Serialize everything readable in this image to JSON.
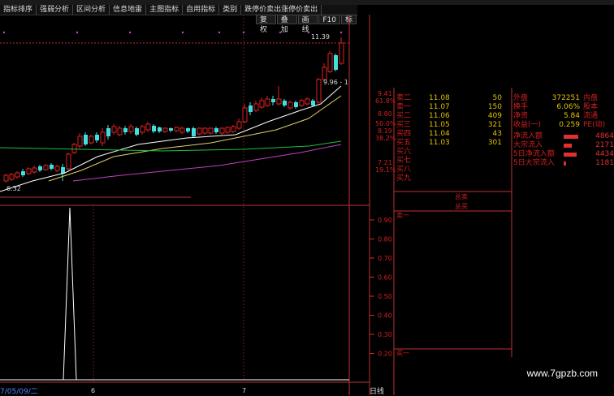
{
  "menu": [
    "指标排序",
    "强弱分析",
    "区间分析",
    "信息地雷",
    "主图指标",
    "自用指标",
    "类别",
    "跌停价卖出涨停价卖出"
  ],
  "subtoolbar": [
    "复权",
    "叠加",
    "画线",
    "F10",
    "标"
  ],
  "price_axis": [
    "9.41",
    "8.80",
    "8.19",
    "7.21"
  ],
  "pct_axis": [
    "61.8%",
    "50.0%",
    "38.2%",
    "19.1%"
  ],
  "hi_label": "11.39",
  "lo_label": "6.32",
  "ma_label": "9.96 - 1",
  "orderbook": {
    "asks": [
      {
        "label": "卖二",
        "price": "11.08",
        "vol": "50"
      },
      {
        "label": "卖一",
        "price": "11.07",
        "vol": "150"
      }
    ],
    "bids": [
      {
        "label": "买二",
        "price": "11.06",
        "vol": "409"
      },
      {
        "label": "买三",
        "price": "11.05",
        "vol": "321"
      },
      {
        "label": "买四",
        "price": "11.04",
        "vol": "43"
      },
      {
        "label": "买五",
        "price": "11.03",
        "vol": "301"
      },
      {
        "label": "买六",
        "price": "",
        "vol": ""
      },
      {
        "label": "买七",
        "price": "",
        "vol": ""
      },
      {
        "label": "买八",
        "price": "",
        "vol": ""
      },
      {
        "label": "买九",
        "price": "",
        "vol": ""
      }
    ]
  },
  "info": [
    {
      "k": "外盘",
      "v": "372251",
      "k2": "内盘"
    },
    {
      "k": "换手",
      "v": "6.06%",
      "k2": "股本"
    },
    {
      "k": "净资",
      "v": "5.84",
      "k2": "流通"
    },
    {
      "k": "收益(一)",
      "v": "0.259",
      "k2": "PE(动)"
    }
  ],
  "flows": [
    {
      "k": "净流入额",
      "v": "4864"
    },
    {
      "k": "大宗流入",
      "v": "2171"
    },
    {
      "k": "5日净流入额",
      "v": "4434"
    },
    {
      "k": "5日大宗流入",
      "v": "1181"
    }
  ],
  "total_sell": "总卖",
  "total_buy": "总买",
  "sell_one": "卖一",
  "buy_one": "买一",
  "ind_axis": [
    "0.90",
    "0.80",
    "0.70",
    "0.60",
    "0.50",
    "0.40",
    "0.30",
    "0.20"
  ],
  "date_label": "7/05/09/二",
  "month_marks": [
    "6",
    "7"
  ],
  "timeframe": "日线",
  "watermark": "www.7gpzb.com",
  "colors": {
    "up": "#e02020",
    "down": "#40e0e0",
    "ma_white": "#ffffff",
    "ma_yellow": "#e0d060",
    "ma_green": "#20c040",
    "ma_purple": "#c040c0"
  }
}
